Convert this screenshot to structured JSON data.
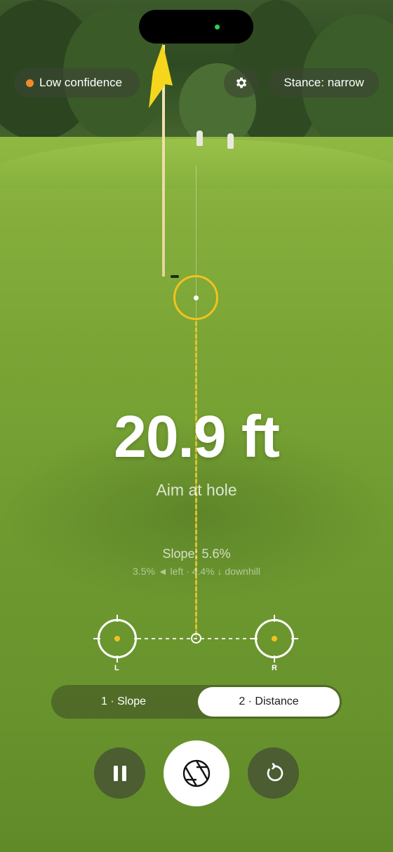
{
  "status": {
    "confidence_label": "Low confidence",
    "confidence_color": "#f08a2a"
  },
  "header": {
    "settings_icon": "gear-icon",
    "stance_label": "Stance: narrow"
  },
  "readout": {
    "distance": "20.9 ft",
    "aim_hint": "Aim at hole",
    "slope": "Slope: 5.6%",
    "slope_detail": "3.5% ◄ left · 4.4% ↓ downhill"
  },
  "markers": {
    "left_label": "L",
    "right_label": "R"
  },
  "mode_tabs": [
    {
      "label": "1 · Slope",
      "selected": false
    },
    {
      "label": "2 · Distance",
      "selected": true
    }
  ],
  "controls": {
    "pause_icon": "pause-icon",
    "capture_icon": "aperture-icon",
    "reset_icon": "reset-icon"
  },
  "colors": {
    "accent_yellow": "#f2c21f",
    "indicator_green": "#29d14f"
  }
}
